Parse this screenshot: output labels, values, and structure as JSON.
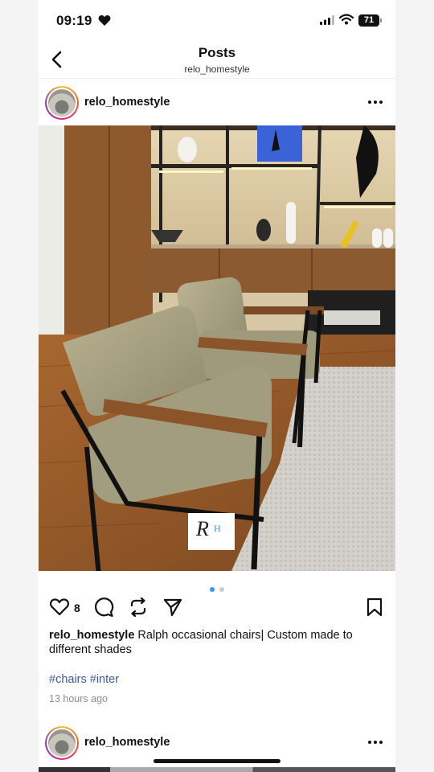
{
  "status_bar": {
    "time": "09:19",
    "battery": "71",
    "icons": [
      "heart-icon",
      "signal-icon",
      "wifi-icon",
      "battery-icon"
    ]
  },
  "header": {
    "title": "Posts",
    "subtitle": "relo_homestyle"
  },
  "post": {
    "username": "relo_homestyle",
    "like_count": "8",
    "caption_username": "relo_homestyle",
    "caption_text": "Ralph occasional chairs| Custom made to different shades",
    "hashtags": [
      "#chairs",
      "#inter"
    ],
    "time_ago": "13 hours ago",
    "carousel": {
      "slides": 2,
      "active": 1
    },
    "watermark_text": "Relo Homestyle"
  },
  "next_post": {
    "username": "relo_homestyle"
  },
  "colors": {
    "accent": "#3897f0",
    "hashtag": "#3c5a99",
    "muted": "#8e8e8e"
  }
}
